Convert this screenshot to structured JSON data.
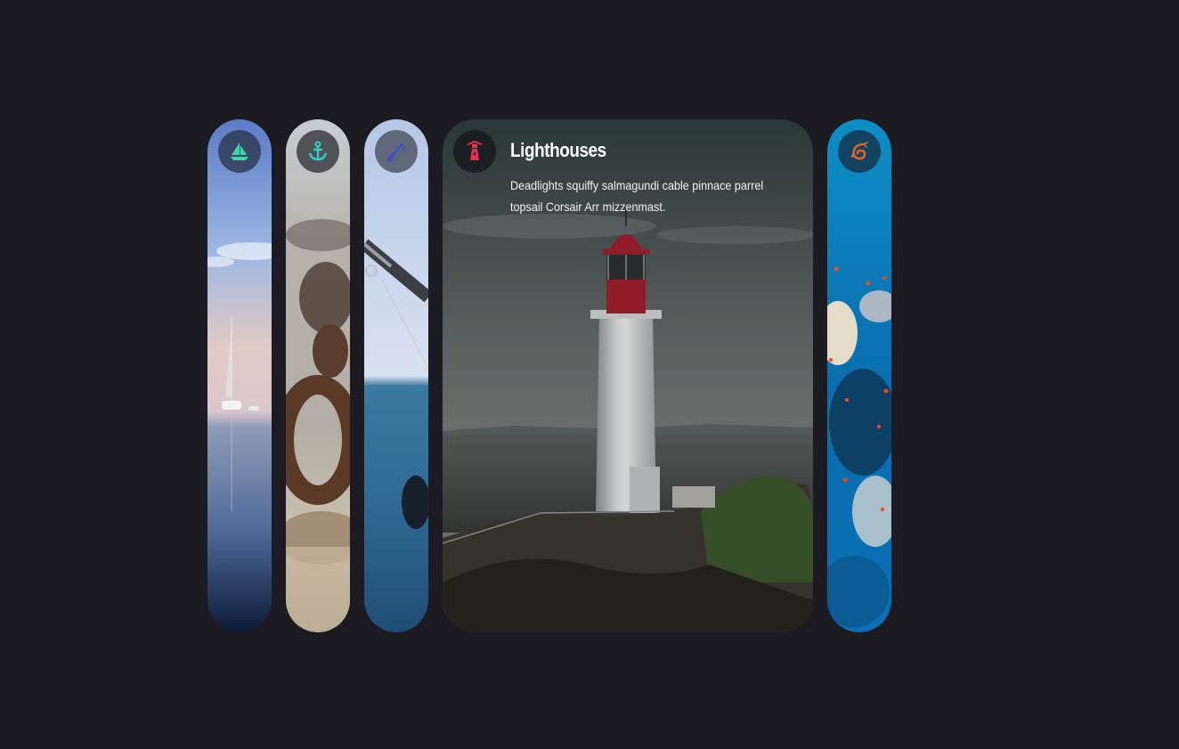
{
  "cards": [
    {
      "id": "sailing",
      "icon": "sailboat-icon",
      "icon_color": "#3fd6a8",
      "active": false
    },
    {
      "id": "anchor",
      "icon": "anchor-icon",
      "icon_color": "#2ed1cf",
      "active": false
    },
    {
      "id": "fishing",
      "icon": "fishing-rod-icon",
      "icon_color": "#3b4fc9",
      "active": false
    },
    {
      "id": "lighthouses",
      "icon": "lighthouse-icon",
      "icon_color": "#e8314f",
      "active": true,
      "title": "Lighthouses",
      "description": "Deadlights squiffy salmagundi cable pinnace parrel topsail Corsair Arr mizzenmast."
    },
    {
      "id": "reef",
      "icon": "shrimp-icon",
      "icon_color": "#e0632a",
      "active": false
    }
  ],
  "colors": {
    "background": "#1c1b22"
  }
}
